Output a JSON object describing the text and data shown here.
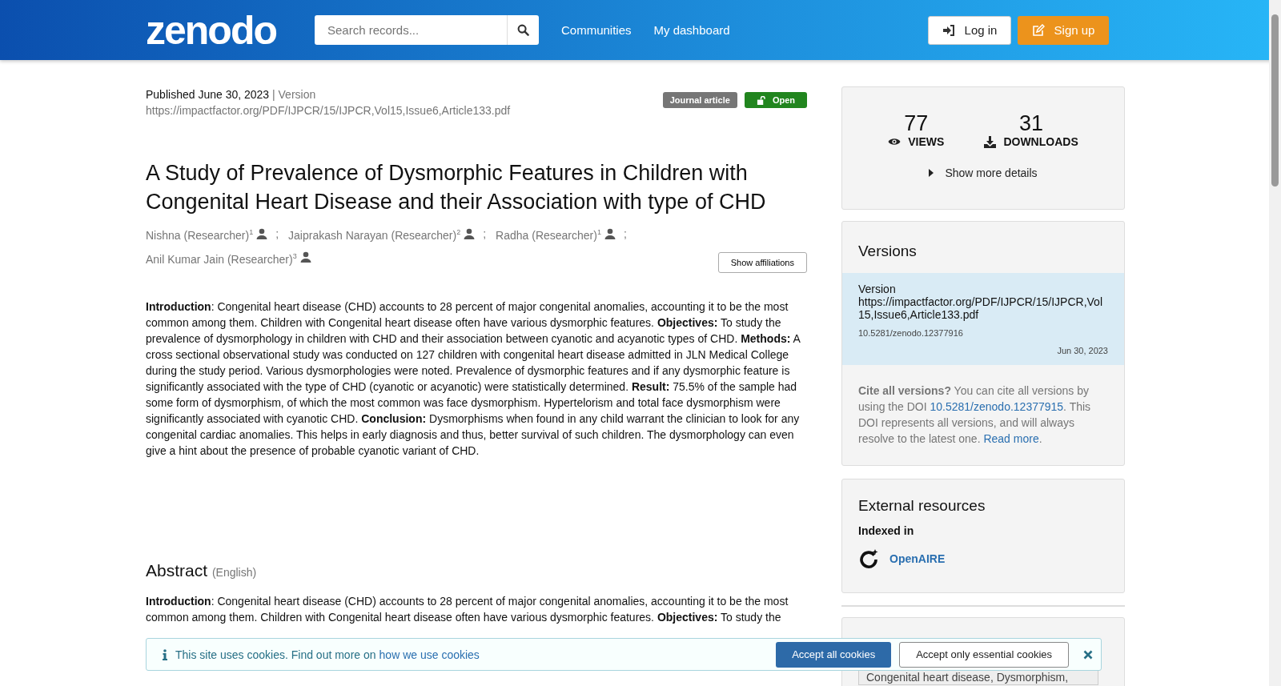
{
  "header": {
    "logo": "zenodo",
    "search": {
      "placeholder": "Search records..."
    },
    "nav": [
      "Communities",
      "My dashboard"
    ],
    "buttons": [
      {
        "kind": "login",
        "label": "Log in"
      },
      {
        "kind": "signup",
        "label": "Sign up"
      }
    ]
  },
  "record": {
    "published": "Published June 30, 2023",
    "version_label": "| Version",
    "version": "https://impactfactor.org/PDF/IJPCR/15/IJPCR,Vol15,Issue6,Article133.pdf",
    "badges": [
      {
        "kind": "type",
        "label": "Journal article"
      },
      {
        "kind": "access",
        "label": "Open"
      }
    ],
    "title": "A Study of Prevalence of Dysmorphic Features in Children with Congenital Heart Disease and their Association with type of CHD",
    "creators": [
      {
        "name": "Nishna (Researcher)",
        "aff": "1",
        "separator": ";"
      },
      {
        "name": "Jaiprakash Narayan (Researcher)",
        "aff": "2",
        "separator": ";"
      },
      {
        "name": "Radha (Researcher)",
        "aff": "1",
        "separator": ";"
      },
      {
        "name": "Anil Kumar Jain (Researcher)",
        "aff": "3"
      }
    ],
    "show_affiliations": "Show affiliations",
    "description": "**Introduction**: Congenital heart disease (CHD) accounts to 28 percent of major congenital anomalies, accounting it to be the most common among them. Children with Congenital heart disease often have various dysmorphic features. **Objectives:** To study the prevalence of dysmorphology in children with CHD and their association between cyanotic and acyanotic types of CHD. **Methods:** A cross sectional observational study was conducted on 127 children with congenital heart disease admitted in JLN Medical College during the study period. Various dysmorphologies were noted. Prevalence of dysmorphic features and if any dysmorphic feature is significantly associated with the type of CHD (cyanotic or acyanotic) were statistically determined. **Result:** 75.5% of the sample had some form of dysmorphism, of which the most common was face dysmorphism. Hypertelorism and total face dysmorphism were significantly associated with cyanotic CHD. **Conclusion:** Dysmorphisms when found in any child warrant the clinician to look for any congenital cardiac anomalies. This helps in early diagnosis and thus, better survival of such children. The dysmorphology can even give a hint about the presence of probable cyanotic variant of CHD.",
    "abstract": {
      "heading": "Abstract",
      "language": "(English)",
      "text": "**Introduction**: Congenital heart disease (CHD) accounts to 28 percent of major congenital anomalies, accounting it to be the most common among them. Children with Congenital heart disease often have various dysmorphic features. **Objectives:** To study the"
    }
  },
  "sidebar": {
    "stats": [
      {
        "kind": "views",
        "value": "77",
        "label": "VIEWS"
      },
      {
        "kind": "downloads",
        "value": "31",
        "label": "DOWNLOADS"
      }
    ],
    "show_more": "Show more details",
    "versions": {
      "title": "Versions",
      "items": [
        {
          "label": "Version https://impactfactor.org/PDF/IJPCR/15/IJPCR,Vol15,Issue6,Article133.pdf",
          "doi": "10.5281/zenodo.12377916",
          "date": "Jun 30, 2023",
          "selected": true
        }
      ],
      "cite_lead": "Cite all versions?",
      "cite_text_1": "You can cite all versions by using the DOI",
      "cite_doi": "10.5281/zenodo.12377915",
      "cite_text_2": ". This DOI represents all versions, and will always resolve to the latest one.",
      "read_more": "Read more",
      "cite_end": "."
    },
    "external": {
      "title": "External resources",
      "subtitle": "Indexed in",
      "link": "OpenAIRE"
    },
    "keywords": "Congenital heart disease, Dysmorphism,"
  },
  "cookie_banner": {
    "text": "This site uses cookies. Find out more on",
    "link": "how we use cookies",
    "buttons": [
      {
        "kind": "primary",
        "label": "Accept all cookies"
      },
      {
        "kind": "secondary",
        "label": "Accept only essential cookies"
      }
    ]
  }
}
